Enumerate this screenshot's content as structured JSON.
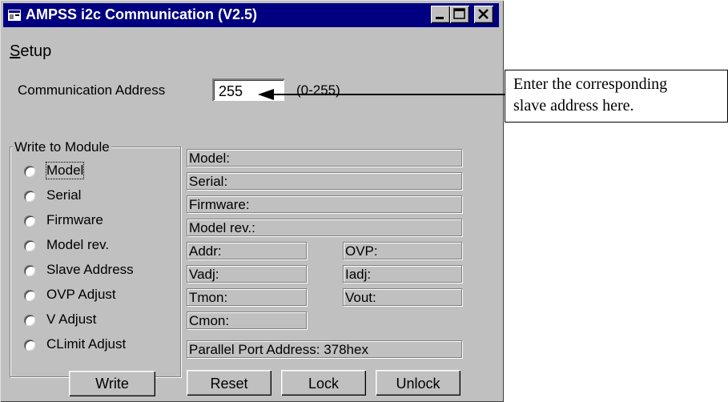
{
  "window": {
    "title": "AMPSS i2c Communication (V2.5)"
  },
  "menu": {
    "setup_rest": "etup",
    "setup_first": "S"
  },
  "comm": {
    "label": "Communication Address",
    "value": "255",
    "range": "(0-255)"
  },
  "write_group": {
    "title": "Write to Module",
    "options": [
      "Model",
      "Serial",
      "Firmware",
      "Model rev.",
      "Slave Address",
      "OVP Adjust",
      "V Adjust",
      "CLimit Adjust"
    ],
    "write_button": "Write"
  },
  "fields": {
    "model": "Model:",
    "serial": "Serial:",
    "firmware": "Firmware:",
    "model_rev": "Model rev.:",
    "addr": "Addr:",
    "vadj": "Vadj:",
    "tmon": "Tmon:",
    "cmon": "Cmon:",
    "ovp": "OVP:",
    "iadj": "Iadj:",
    "vout": "Vout:",
    "parallel": "Parallel Port Address: 378hex"
  },
  "buttons": {
    "reset": "Reset",
    "lock": "Lock",
    "unlock": "Unlock"
  },
  "annotation": {
    "line1": "Enter the corresponding",
    "line2": "slave address here."
  }
}
